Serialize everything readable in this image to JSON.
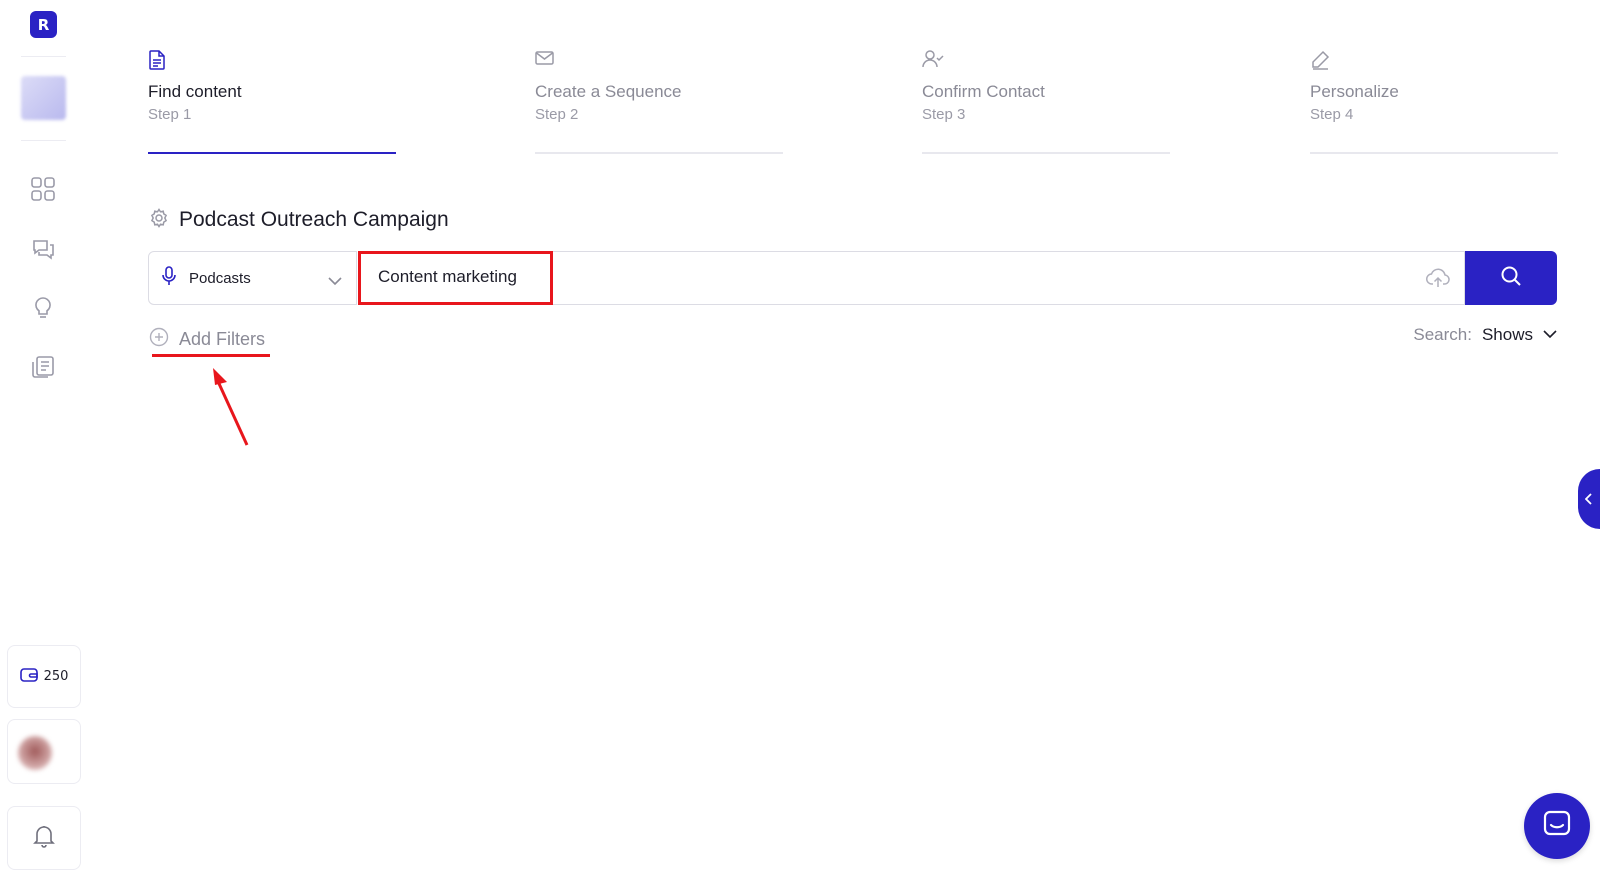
{
  "app": {
    "logo_letter": "R",
    "brand_color": "#2a22c4",
    "highlight_color": "#e8161c"
  },
  "sidebar": {
    "nav": [
      {
        "name": "dashboard",
        "icon": "grid-icon"
      },
      {
        "name": "messages",
        "icon": "chat-bubbles-icon"
      },
      {
        "name": "ideas",
        "icon": "lightbulb-icon"
      },
      {
        "name": "campaigns",
        "icon": "documents-icon"
      }
    ],
    "credits": "250",
    "credits_icon": "wallet-icon",
    "notifications_icon": "bell-icon"
  },
  "steps": [
    {
      "title": "Find content",
      "subtitle": "Step 1",
      "icon": "document-icon",
      "active": true
    },
    {
      "title": "Create a Sequence",
      "subtitle": "Step 2",
      "icon": "envelope-icon",
      "active": false
    },
    {
      "title": "Confirm Contact",
      "subtitle": "Step 3",
      "icon": "user-check-icon",
      "active": false
    },
    {
      "title": "Personalize",
      "subtitle": "Step 4",
      "icon": "pen-icon",
      "active": false
    }
  ],
  "campaign": {
    "title": "Podcast Outreach Campaign",
    "icon": "gear-icon"
  },
  "search": {
    "type_label": "Podcasts",
    "query": "Content marketing",
    "add_filters_label": "Add Filters",
    "mode_label": "Search:",
    "mode_value": "Shows"
  }
}
